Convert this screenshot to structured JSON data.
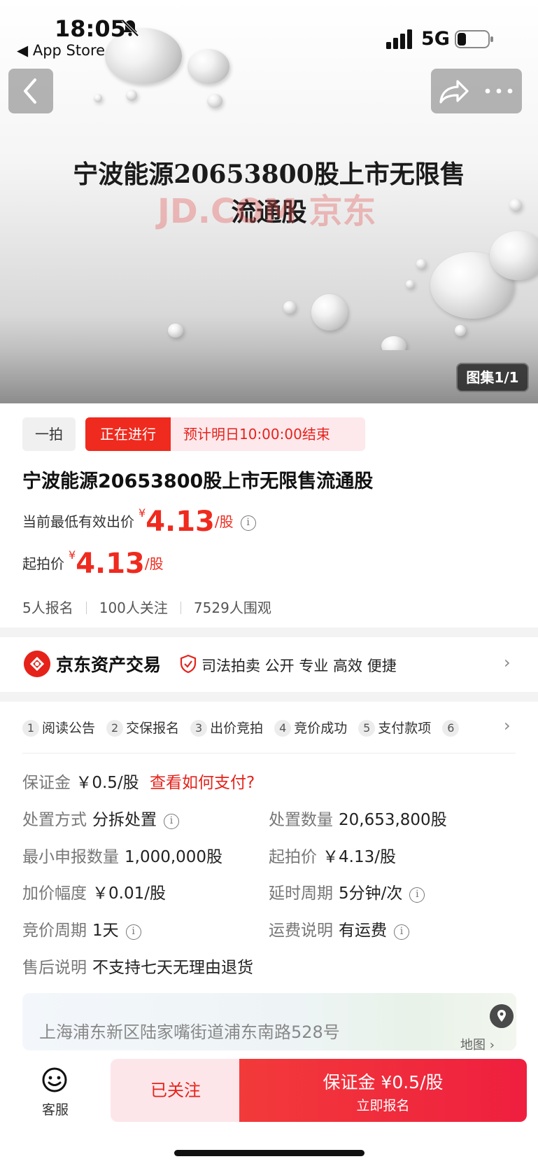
{
  "status_bar": {
    "time": "18:05",
    "back_label": "◀ App Store",
    "network": "5G"
  },
  "hero": {
    "title_line1": "宁波能源20653800股上市无限售",
    "title_line2": "流通股",
    "watermark": "JD.COM 京东",
    "album_badge": "图集1/1"
  },
  "auction": {
    "type_tag": "一拍",
    "status_tag": "正在进行",
    "end_text": "预计明日10:00:00结束",
    "title": "宁波能源20653800股上市无限售流通股",
    "current_label": "当前最低有效出价",
    "current_price": "4.13",
    "start_label": "起拍价",
    "start_price": "4.13",
    "currency": "¥",
    "unit": "/股",
    "stats": [
      "5人报名",
      "100人关注",
      "7529人围观"
    ]
  },
  "seller": {
    "name": "京东资产交易",
    "tags": "司法拍卖   公开  专业  高效  便捷"
  },
  "steps": [
    {
      "num": "1",
      "label": "阅读公告"
    },
    {
      "num": "2",
      "label": "交保报名"
    },
    {
      "num": "3",
      "label": "出价竞拍"
    },
    {
      "num": "4",
      "label": "竞价成功"
    },
    {
      "num": "5",
      "label": "支付款项"
    },
    {
      "num": "6",
      "label": ""
    }
  ],
  "details": {
    "deposit_label": "保证金",
    "deposit_value": "￥0.5/股",
    "deposit_link": "查看如何支付?",
    "method_label": "处置方式",
    "method_value": "分拆处置",
    "quantity_label": "处置数量",
    "quantity_value": "20,653,800股",
    "min_label": "最小申报数量",
    "min_value": "1,000,000股",
    "start_label": "起拍价",
    "start_value": "￥4.13/股",
    "increment_label": "加价幅度",
    "increment_value": "￥0.01/股",
    "delay_label": "延时周期",
    "delay_value": "5分钟/次",
    "cycle_label": "竞价周期",
    "cycle_value": "1天",
    "freight_label": "运费说明",
    "freight_value": "有运费",
    "aftersale_label": "售后说明",
    "aftersale_value": "不支持七天无理由退货"
  },
  "address": {
    "text": "上海浦东新区陆家嘴街道浦东南路528号",
    "map_label": "地图"
  },
  "bottom_bar": {
    "service_label": "客服",
    "follow_label": "已关注",
    "enroll_main": "保证金 ¥0.5/股",
    "enroll_sub": "立即报名"
  },
  "colors": {
    "accent_red": "#ef2a1e",
    "pink_bg": "#fde6ea"
  }
}
